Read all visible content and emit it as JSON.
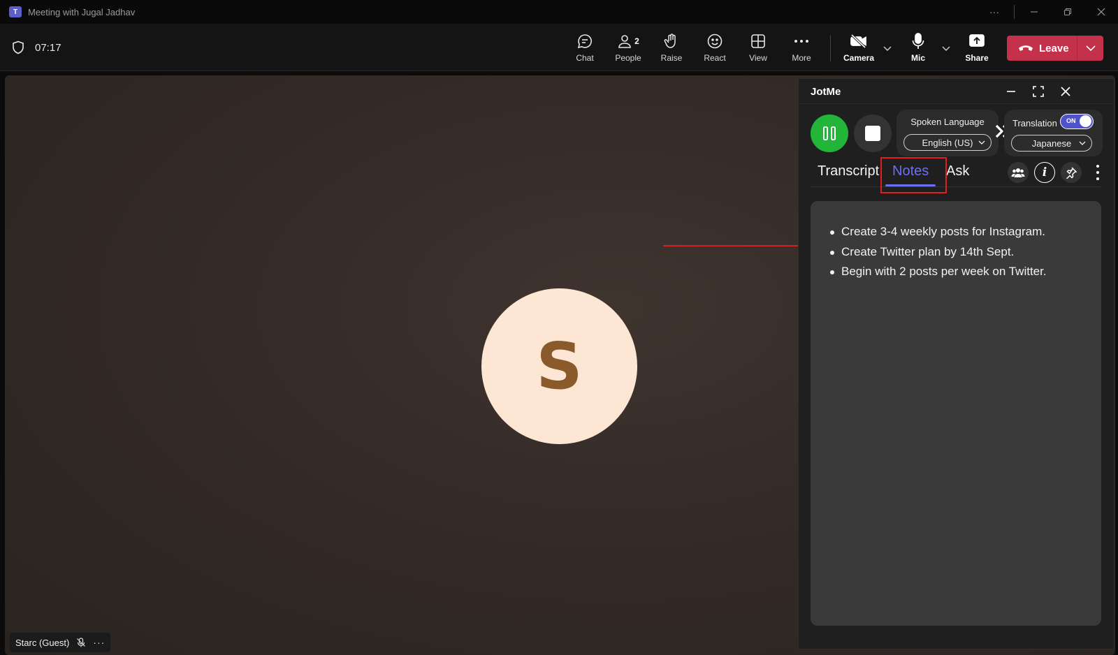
{
  "window": {
    "title": "Meeting with Jugal Jadhav",
    "app_logo_letter": "T"
  },
  "toolbar": {
    "timer": "07:17",
    "buttons": [
      {
        "id": "chat",
        "label": "Chat",
        "icon": "chat-icon"
      },
      {
        "id": "people",
        "label": "People",
        "icon": "people-icon",
        "badge": "2"
      },
      {
        "id": "raise",
        "label": "Raise",
        "icon": "hand-icon"
      },
      {
        "id": "react",
        "label": "React",
        "icon": "smiley-icon"
      },
      {
        "id": "view",
        "label": "View",
        "icon": "grid-icon"
      },
      {
        "id": "more",
        "label": "More",
        "icon": "ellipsis-icon"
      },
      {
        "id": "camera",
        "label": "Camera",
        "icon": "camera-off-icon"
      },
      {
        "id": "mic",
        "label": "Mic",
        "icon": "mic-icon"
      },
      {
        "id": "share",
        "label": "Share",
        "icon": "share-icon"
      }
    ],
    "leave_label": "Leave",
    "leave_color": "#c4314b"
  },
  "stage": {
    "avatar_initial": "S",
    "avatar_bg": "#fde7d4",
    "avatar_fg": "#8a5a2b",
    "participant_name": "Starc (Guest)",
    "participant_more": "···"
  },
  "jotme": {
    "brand": "JotMe",
    "spoken_language_title": "Spoken Language",
    "spoken_language_value": "English (US)",
    "translation_title": "Translation",
    "translation_toggle": "ON",
    "translation_language_value": "Japanese",
    "record_color": "#22b53a",
    "accent": "#6b6ff0",
    "tabs": {
      "transcript": "Transcript",
      "notes": "Notes",
      "ask": "Ask"
    },
    "active_tab": "Notes",
    "notes": [
      "Create 3-4 weekly posts for Instagram.",
      "Create Twitter plan by 14th Sept.",
      "Begin with 2 posts per week on Twitter."
    ]
  }
}
